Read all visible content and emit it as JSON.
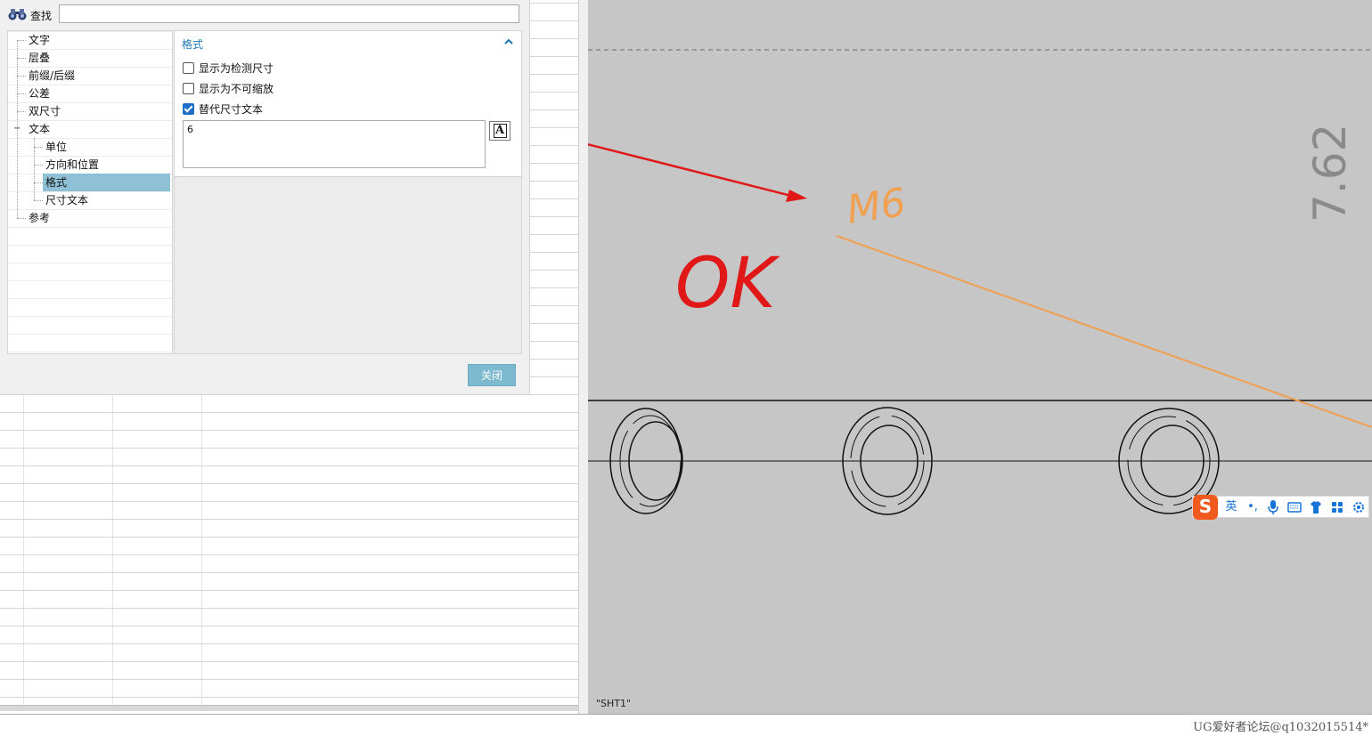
{
  "find": {
    "label": "查找",
    "value": "",
    "icon": "binoculars-icon"
  },
  "tree": {
    "items": [
      {
        "label": "文字",
        "level": 0
      },
      {
        "label": "层叠",
        "level": 0
      },
      {
        "label": "前缀/后缀",
        "level": 0
      },
      {
        "label": "公差",
        "level": 0
      },
      {
        "label": "双尺寸",
        "level": 0
      },
      {
        "label": "文本",
        "level": 0,
        "expanded": true
      },
      {
        "label": "单位",
        "level": 1
      },
      {
        "label": "方向和位置",
        "level": 1
      },
      {
        "label": "格式",
        "level": 1,
        "selected": true
      },
      {
        "label": "尺寸文本",
        "level": 1
      },
      {
        "label": "参考",
        "level": 0
      }
    ],
    "expander": "−"
  },
  "format_panel": {
    "title": "格式",
    "options": [
      {
        "label": "显示为检测尺寸",
        "checked": false
      },
      {
        "label": "显示为不可缩放",
        "checked": false
      },
      {
        "label": "替代尺寸文本",
        "checked": true
      }
    ],
    "alt_text_value": "6",
    "text_format_button": "A"
  },
  "close_button": "关闭",
  "canvas": {
    "sheet_label": "\"SHT1\"",
    "dimension_text": "M6",
    "handwritten_note": "OK",
    "rotated_dimension": "7.62",
    "colors": {
      "background": "#c6c6c6",
      "annotation_arrow": "#e01818",
      "dimension": "#f0a050",
      "geometry": "#111111"
    }
  },
  "ime_toolbar": {
    "logo": "S",
    "mode": "英",
    "punct": "•,",
    "icons": [
      "microphone-icon",
      "keyboard-icon",
      "skin-icon",
      "apps-icon",
      "settings-icon"
    ]
  },
  "watermark": "UG爱好者论坛@q1032015514*",
  "colors": {
    "accent": "#1e78b4",
    "selection": "#8fc1d6",
    "close_button": "#7db9cf",
    "checkbox": "#1e6fc8"
  }
}
